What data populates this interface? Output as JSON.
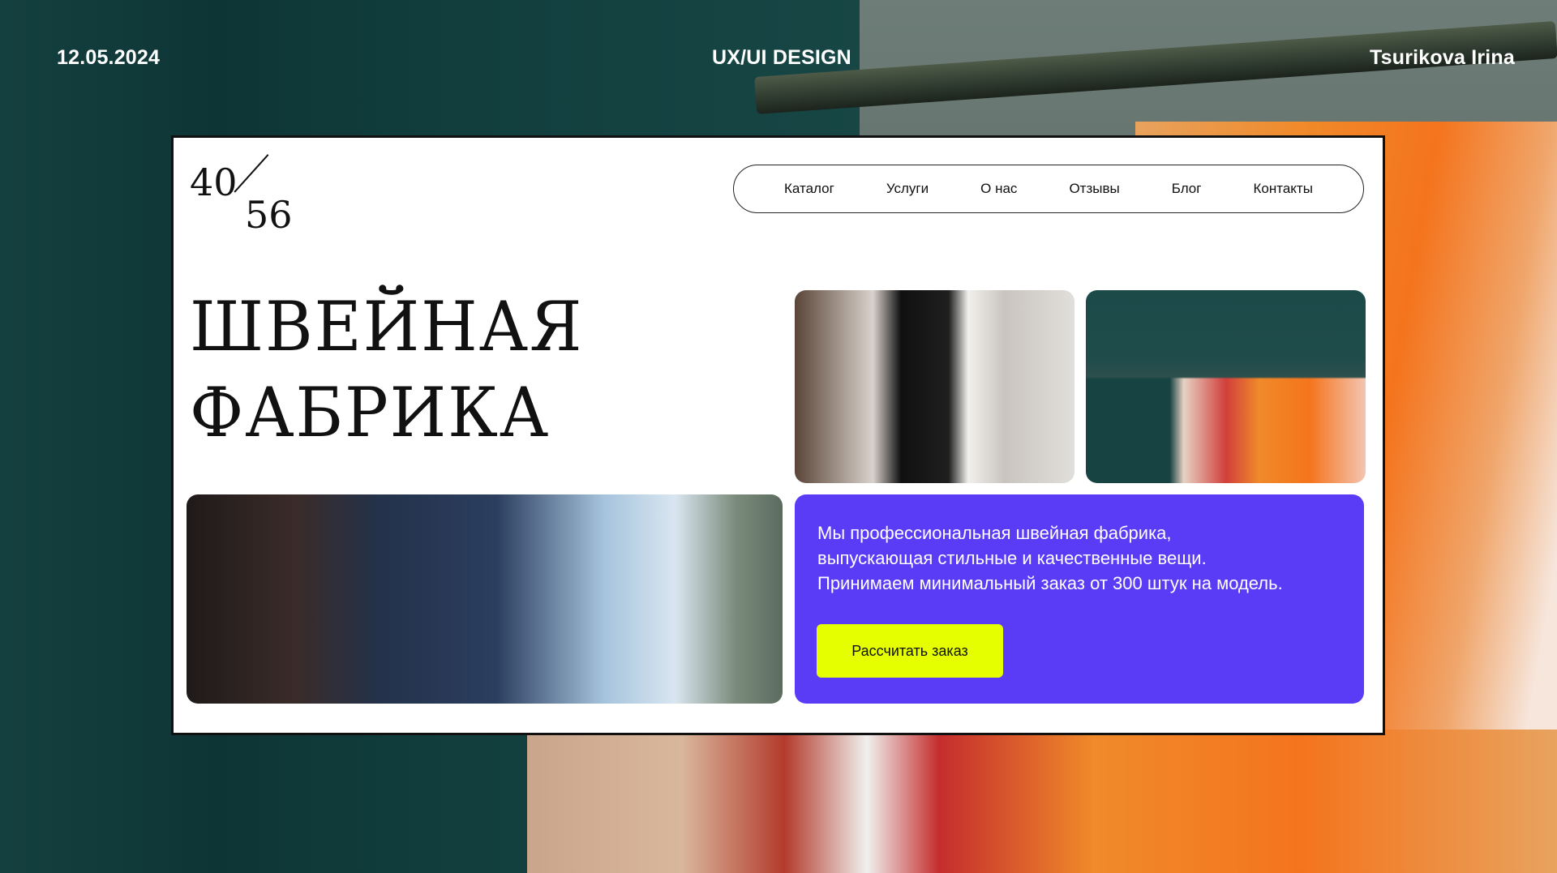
{
  "header": {
    "date": "12.05.2024",
    "title": "UX/UI DESIGN",
    "author": "Tsurikova Irina"
  },
  "site": {
    "logo": {
      "top": "40",
      "bottom": "56"
    },
    "nav": [
      "Каталог",
      "Услуги",
      "О нас",
      "Отзывы",
      "Блог",
      "Контакты"
    ],
    "headline": {
      "line1": "ШВЕЙНАЯ",
      "line2": "ФАБРИКА"
    },
    "promo": {
      "lines": [
        "Мы профессиональная швейная фабрика,",
        "выпускающая стильные и качественные вещи.",
        "Принимаем минимальный заказ от 300 штук на модель."
      ],
      "button": "Рассчитать заказ"
    }
  },
  "colors": {
    "accent": "#5a3cf6",
    "button": "#e6ff00",
    "background": "#0f3a3b"
  }
}
